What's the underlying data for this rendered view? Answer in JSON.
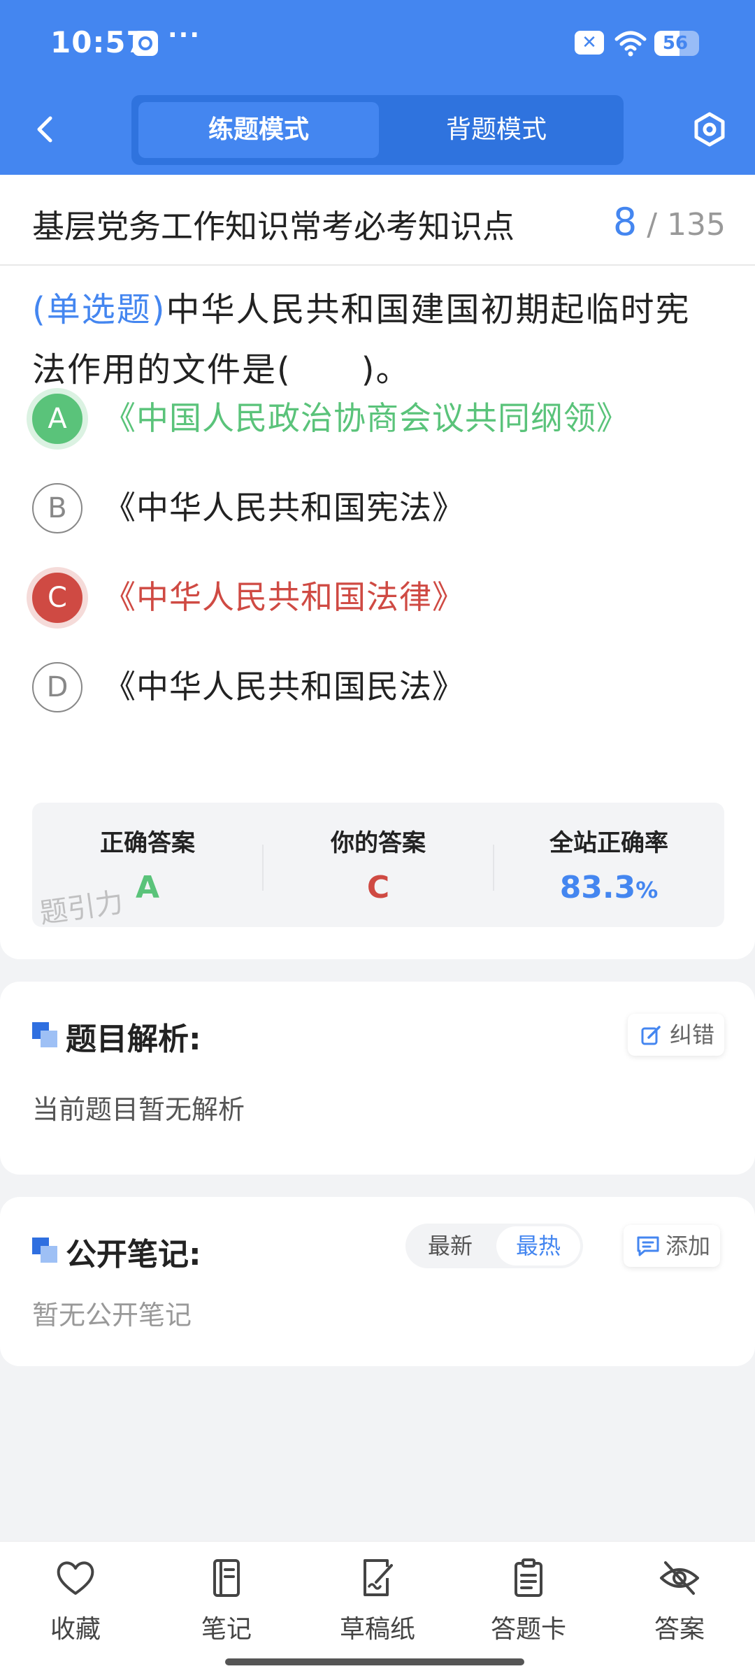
{
  "status_bar": {
    "time": "10:57",
    "more": "···",
    "battery": "56"
  },
  "header": {
    "modes": [
      "练题模式",
      "背题模式"
    ],
    "active_mode": "练题模式"
  },
  "bank": {
    "title": "基层党务工作知识常考必考知识点",
    "current": "8",
    "total": "/ 135"
  },
  "question": {
    "type": "(单选题)",
    "text": "中华人民共和国建国初期起临时宪法作用的文件是(　　)。",
    "options": [
      {
        "letter": "A",
        "text": "《中国人民政治协商会议共同纲领》",
        "state": "correct"
      },
      {
        "letter": "B",
        "text": "《中华人民共和国宪法》",
        "state": "normal"
      },
      {
        "letter": "C",
        "text": "《中华人民共和国法律》",
        "state": "wrong"
      },
      {
        "letter": "D",
        "text": "《中华人民共和国民法》",
        "state": "normal"
      }
    ]
  },
  "result": {
    "correct_label": "正确答案",
    "correct_value": "A",
    "yours_label": "你的答案",
    "yours_value": "C",
    "rate_label": "全站正确率",
    "rate_value": "83.3",
    "rate_unit": "%",
    "watermark": "题引力"
  },
  "analysis": {
    "title": "题目解析:",
    "report_btn": "纠错",
    "body": "当前题目暂无解析"
  },
  "notes": {
    "title": "公开笔记:",
    "sort_latest": "最新",
    "sort_hot": "最热",
    "add_btn": "添加",
    "body": "暂无公开笔记"
  },
  "bottom_nav": [
    {
      "label": "收藏",
      "icon": "heart-icon"
    },
    {
      "label": "笔记",
      "icon": "notebook-icon"
    },
    {
      "label": "草稿纸",
      "icon": "draft-paper-icon"
    },
    {
      "label": "答题卡",
      "icon": "answer-sheet-icon"
    },
    {
      "label": "答案",
      "icon": "eye-off-icon"
    }
  ],
  "colors": {
    "brand": "#4486f0",
    "correct": "#5ac37a",
    "wrong": "#cf4a43"
  }
}
